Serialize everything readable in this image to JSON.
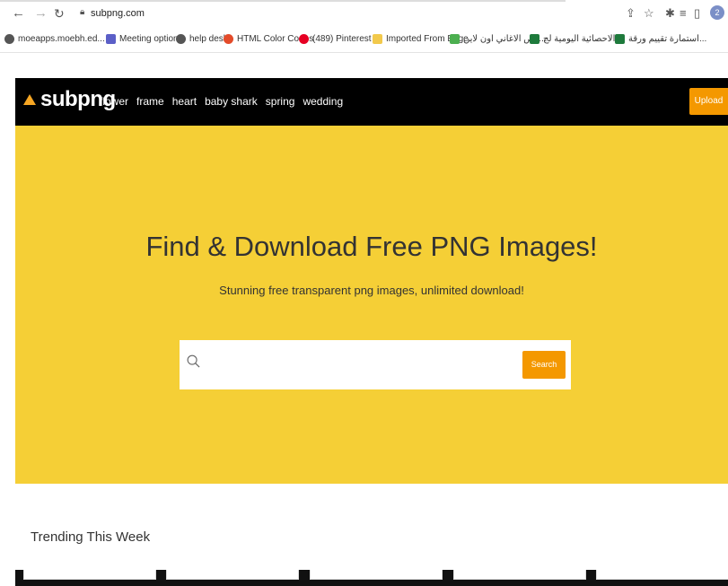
{
  "browser": {
    "url": "subpng.com",
    "avatar_letter": "2",
    "bookmarks": [
      {
        "label": "moeapps.moebh.ed...",
        "icon": "globe-icon"
      },
      {
        "label": "Meeting options",
        "icon": "teams-icon"
      },
      {
        "label": "help desk",
        "icon": "globe-icon"
      },
      {
        "label": "HTML Color Codes",
        "icon": "htmlcolor-icon"
      },
      {
        "label": "(489) Pinterest",
        "icon": "pinterest-icon"
      },
      {
        "label": "Imported From Edge",
        "icon": "folder-icon"
      },
      {
        "label": "قص الاغاني اون لاين...",
        "icon": "puzzle-icon"
      },
      {
        "label": "الاحصائية اليومية لج...",
        "icon": "forms-icon"
      },
      {
        "label": "استمارة تقييم ورقة...",
        "icon": "forms-icon"
      }
    ]
  },
  "header": {
    "logo": "subpng",
    "nav": [
      "flower",
      "frame",
      "heart",
      "baby shark",
      "spring",
      "wedding"
    ],
    "upload_label": "Upload"
  },
  "hero": {
    "title": "Find & Download Free PNG Images!",
    "subtitle": "Stunning free transparent png images, unlimited download!",
    "search_placeholder": "",
    "search_button": "Search"
  },
  "trending": {
    "title": "Trending This Week"
  },
  "colors": {
    "hero_bg": "#f5cf36",
    "accent": "#f49800",
    "header_bg": "#000000"
  }
}
